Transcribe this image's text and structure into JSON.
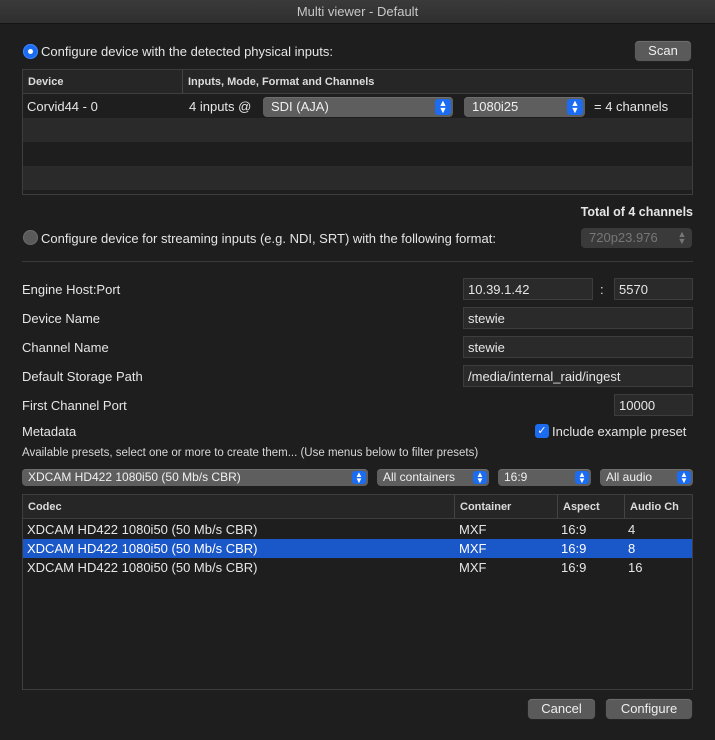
{
  "window": {
    "title": "Multi viewer - Default"
  },
  "physical": {
    "radio_label": "Configure device with the detected physical inputs:",
    "scan_label": "Scan",
    "table": {
      "headers": [
        "Device",
        "Inputs, Mode, Format and Channels"
      ],
      "row": {
        "device": "Corvid44 - 0",
        "inputs_text": "4 inputs @",
        "mode": "SDI (AJA)",
        "format": "1080i25",
        "channels_text": "= 4 channels"
      }
    },
    "total": "Total of 4 channels"
  },
  "streaming": {
    "radio_label": "Configure device for streaming inputs (e.g. NDI, SRT) with the following format:",
    "format": "720p23.976"
  },
  "settings": {
    "engine_host_label": "Engine Host:Port",
    "engine_host": "10.39.1.42",
    "colon": ":",
    "engine_port": "5570",
    "device_name_label": "Device Name",
    "device_name": "stewie",
    "channel_name_label": "Channel Name",
    "channel_name": "stewie",
    "storage_path_label": "Default Storage Path",
    "storage_path": "/media/internal_raid/ingest",
    "first_port_label": "First Channel Port",
    "first_port": "10000",
    "metadata_label": "Metadata",
    "include_example_label": "Include example preset"
  },
  "presets": {
    "hint": "Available presets, select one or more to create them... (Use menus below to filter presets)",
    "filters": {
      "codec": "XDCAM HD422 1080i50 (50 Mb/s CBR)",
      "container": "All containers",
      "aspect": "16:9",
      "audio": "All audio"
    },
    "headers": [
      "Codec",
      "Container",
      "Aspect",
      "Audio Ch"
    ],
    "rows": [
      {
        "codec": "XDCAM HD422 1080i50 (50 Mb/s CBR)",
        "container": "MXF",
        "aspect": "16:9",
        "audio": "4"
      },
      {
        "codec": "XDCAM HD422 1080i50 (50 Mb/s CBR)",
        "container": "MXF",
        "aspect": "16:9",
        "audio": "8"
      },
      {
        "codec": "XDCAM HD422 1080i50 (50 Mb/s CBR)",
        "container": "MXF",
        "aspect": "16:9",
        "audio": "16"
      }
    ],
    "selected_row": 1
  },
  "footer": {
    "cancel_label": "Cancel",
    "configure_label": "Configure"
  },
  "colors": {
    "accent": "#1b6cf0",
    "selection": "#1a57c9",
    "background": "#1e1e1e"
  },
  "icons": {
    "popup_chevron": "chevron-up-down-icon",
    "checkmark": "checkmark-icon"
  }
}
